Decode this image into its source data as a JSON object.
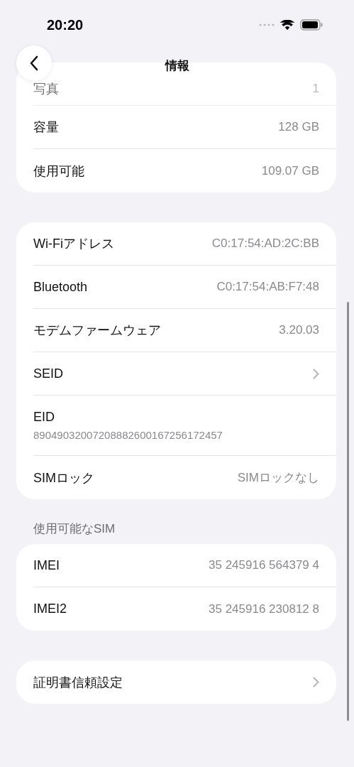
{
  "status_bar": {
    "time": "20:20"
  },
  "nav": {
    "title": "情報"
  },
  "sections": [
    {
      "rows": [
        {
          "kind": "value",
          "label": "写真",
          "value": "1",
          "faded": true
        },
        {
          "kind": "value",
          "label": "容量",
          "value": "128 GB",
          "faded": false
        },
        {
          "kind": "value",
          "label": "使用可能",
          "value": "109.07 GB",
          "faded": false
        }
      ]
    },
    {
      "rows": [
        {
          "kind": "value",
          "label": "Wi-Fiアドレス",
          "value": "C0:17:54:AD:2C:BB",
          "faded": false
        },
        {
          "kind": "value",
          "label": "Bluetooth",
          "value": "C0:17:54:AB:F7:48",
          "faded": false
        },
        {
          "kind": "value",
          "label": "モデムファームウェア",
          "value": "3.20.03",
          "faded": false
        },
        {
          "kind": "link",
          "label": "SEID",
          "faded": false
        },
        {
          "kind": "stacked",
          "label": "EID",
          "value": "89049032007208882600167256172457",
          "faded": false
        },
        {
          "kind": "value",
          "label": "SIMロック",
          "value": "SIMロックなし",
          "faded": false
        }
      ]
    },
    {
      "header": "使用可能なSIM",
      "rows": [
        {
          "kind": "value",
          "label": "IMEI",
          "value": "35 245916 564379 4",
          "faded": false
        },
        {
          "kind": "value",
          "label": "IMEI2",
          "value": "35 245916 230812 8",
          "faded": false
        }
      ]
    },
    {
      "rows": [
        {
          "kind": "link",
          "label": "証明書信頼設定",
          "faded": false
        }
      ]
    }
  ]
}
